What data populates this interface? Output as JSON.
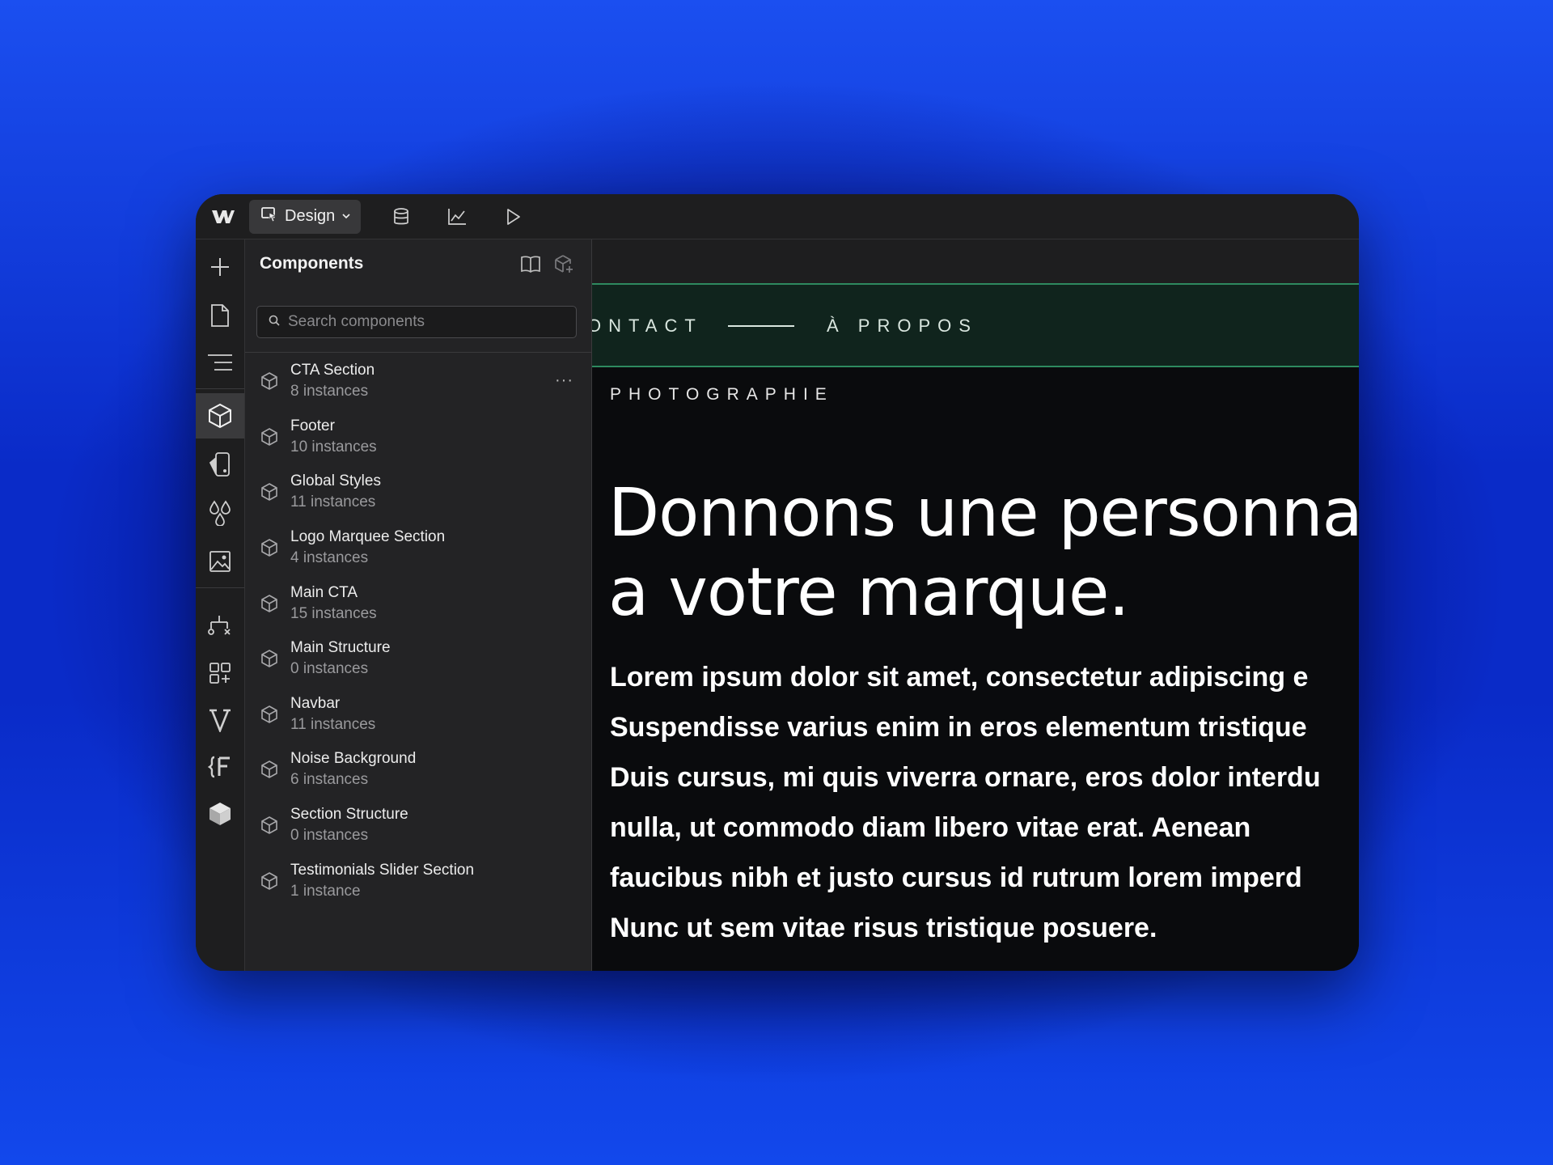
{
  "colors": {
    "background": "#0a2bc8",
    "window": "#1e1e1f",
    "panel": "#232325",
    "canvas": "#0a0b0d",
    "accent_green": "#2e8a5f"
  },
  "toolbar": {
    "logo_icon": "webflow-logo-icon",
    "mode_label": "Design",
    "mode_icon": "cursor-select-icon",
    "icons": [
      "database-icon",
      "analytics-chart-icon",
      "preview-play-icon"
    ]
  },
  "rail": {
    "icons": [
      "add-icon",
      "page-icon",
      "navigator-icon",
      "components-icon",
      "style-manager-icon",
      "variables-icon",
      "assets-icon",
      "logic-icon",
      "apps-icon",
      "v-plugin-icon",
      "finsweet-icon",
      "box-icon"
    ]
  },
  "panel": {
    "title": "Components",
    "search": {
      "placeholder": "Search components",
      "value": ""
    },
    "components": [
      {
        "name": "CTA Section",
        "count": "8 instances"
      },
      {
        "name": "Footer",
        "count": "10 instances"
      },
      {
        "name": "Global Styles",
        "count": "11 instances"
      },
      {
        "name": "Logo Marquee Section",
        "count": "4 instances"
      },
      {
        "name": "Main CTA",
        "count": "15 instances"
      },
      {
        "name": "Main Structure",
        "count": "0 instances"
      },
      {
        "name": "Navbar",
        "count": "11 instances"
      },
      {
        "name": "Noise Background",
        "count": "6 instances"
      },
      {
        "name": "Section Structure",
        "count": "0 instances"
      },
      {
        "name": "Testimonials Slider Section",
        "count": "1 instance"
      }
    ],
    "more_label": "···"
  },
  "canvas": {
    "nav_left": "ONTACT",
    "nav_right": "À PROPOS",
    "eyebrow": "PHOTOGRAPHIE",
    "headline_line1": "Donnons une personnalit",
    "headline_line2": "a votre marque.",
    "body": [
      "Lorem ipsum dolor sit amet, consectetur adipiscing e",
      "Suspendisse varius enim in eros elementum tristique",
      "Duis cursus, mi quis viverra ornare, eros dolor interdu",
      "nulla, ut commodo diam libero vitae erat. Aenean",
      "faucibus nibh et justo cursus id rutrum lorem imperd",
      "Nunc ut sem vitae risus tristique posuere."
    ]
  }
}
